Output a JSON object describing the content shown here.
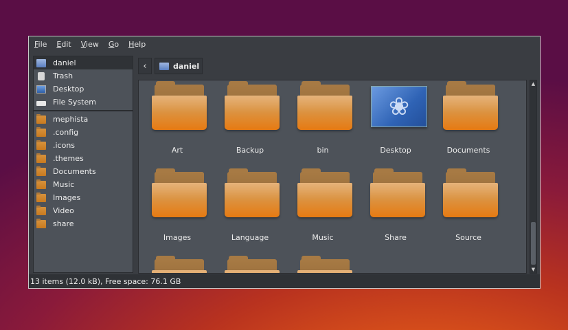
{
  "menu": [
    {
      "label": "File",
      "u": "F",
      "rest": "ile"
    },
    {
      "label": "Edit",
      "u": "E",
      "rest": "dit"
    },
    {
      "label": "View",
      "u": "V",
      "rest": "iew"
    },
    {
      "label": "Go",
      "u": "G",
      "rest": "o"
    },
    {
      "label": "Help",
      "u": "H",
      "rest": "elp"
    }
  ],
  "sidebar": {
    "places": [
      {
        "label": "daniel",
        "icon": "home-folder-icon"
      },
      {
        "label": "Trash",
        "icon": "trash-icon"
      },
      {
        "label": "Desktop",
        "icon": "desktop-icon"
      },
      {
        "label": "File System",
        "icon": "drive-icon"
      }
    ],
    "bookmarks": [
      {
        "label": "mephista"
      },
      {
        "label": ".config"
      },
      {
        "label": ".icons"
      },
      {
        "label": ".themes"
      },
      {
        "label": "Documents"
      },
      {
        "label": "Music"
      },
      {
        "label": "Images"
      },
      {
        "label": "Video"
      },
      {
        "label": "share"
      }
    ]
  },
  "pathbar": {
    "back_icon": "chevron-left-icon",
    "crumb": "daniel"
  },
  "files": [
    {
      "name": "Art",
      "type": "folder"
    },
    {
      "name": "Backup",
      "type": "folder"
    },
    {
      "name": "bin",
      "type": "folder"
    },
    {
      "name": "Desktop",
      "type": "desktop"
    },
    {
      "name": "Documents",
      "type": "folder"
    },
    {
      "name": "Images",
      "type": "folder"
    },
    {
      "name": "Language",
      "type": "folder"
    },
    {
      "name": "Music",
      "type": "folder"
    },
    {
      "name": "Share",
      "type": "folder"
    },
    {
      "name": "Source",
      "type": "folder"
    },
    {
      "name": "",
      "type": "folder"
    },
    {
      "name": "",
      "type": "folder"
    },
    {
      "name": "",
      "type": "folder"
    }
  ],
  "status": "13 items (12.0 kB), Free space: 76.1 GB"
}
